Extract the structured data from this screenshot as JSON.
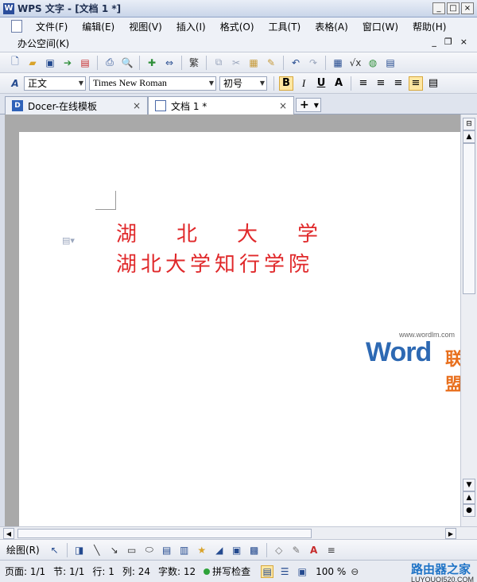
{
  "window": {
    "title": "WPS 文字 - [文档 1 *]",
    "icon": "W"
  },
  "menu": {
    "items": [
      "文件(F)",
      "编辑(E)",
      "视图(V)",
      "插入(I)",
      "格式(O)",
      "工具(T)",
      "表格(A)",
      "窗口(W)",
      "帮助(H)"
    ],
    "second_row": "办公空间(K)"
  },
  "format_bar": {
    "style": "正文",
    "font": "Times New Roman",
    "size": "初号",
    "bold": "B",
    "italic": "I",
    "underline": "U",
    "char_size": "A"
  },
  "tabs": [
    {
      "label": "Docer-在线模板"
    },
    {
      "label": "文档 1 *"
    }
  ],
  "document": {
    "line1": "湖北大学",
    "line2": "湖北大学知行学院"
  },
  "watermark": {
    "site": "www.wordlm.com",
    "word": "Word",
    "suffix": "联盟"
  },
  "drawbar": {
    "label": "绘图(R)"
  },
  "status": {
    "page": "页面: 1/1",
    "section": "节: 1/1",
    "line": "行: 1",
    "column": "列: 24",
    "word_count": "字数: 12",
    "spell_check": "拼写检查",
    "zoom": "100 %"
  },
  "brand": {
    "cn": "路由器之家",
    "en": "LUYOUQI520.COM"
  },
  "colors": {
    "document_text": "#e0282a",
    "accent": "#2a4d9b"
  }
}
